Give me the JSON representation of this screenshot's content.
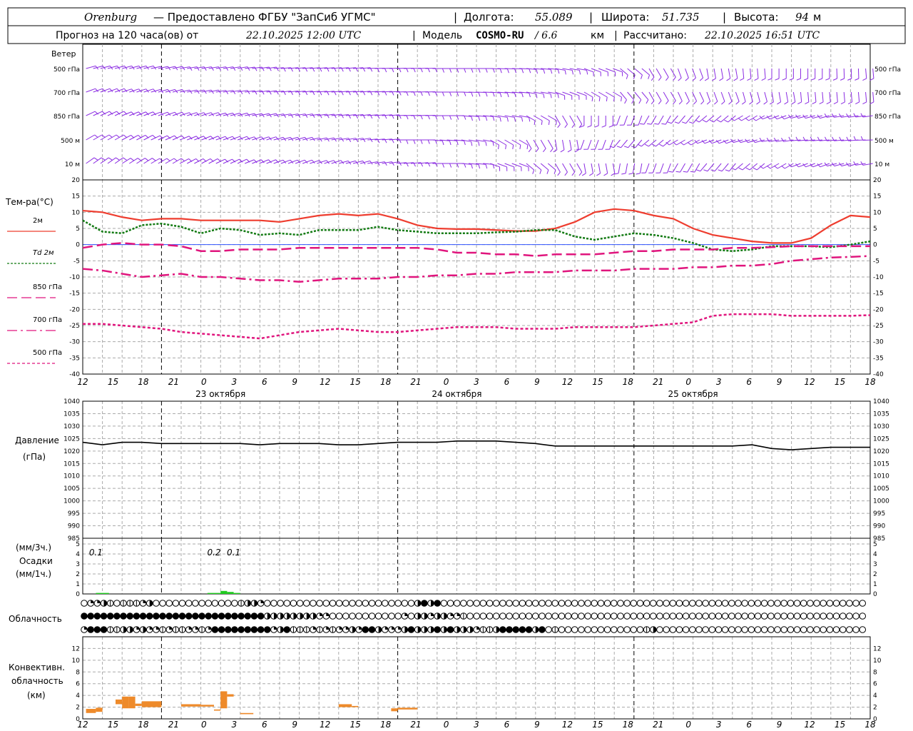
{
  "header": {
    "station": "Orenburg",
    "provider": "— Предоставлено ФГБУ \"ЗапСиб УГМС\"",
    "lon_label": "Долгота:",
    "lon_value": "55.089",
    "lat_label": "Широта:",
    "lat_value": "51.735",
    "alt_label": "Высота:",
    "alt_value": "94",
    "alt_unit": "м",
    "forecast_prefix": "Прогноз на 120 часа(ов) от",
    "forecast_start": "22.10.2025 12:00 UTC",
    "model_label": "Модель",
    "model_name": "COSMO-RU",
    "model_res": "/ 6.6",
    "model_res_unit": "км",
    "computed_label": "Рассчитано:",
    "computed_value": "22.10.2025 16:51 UTC"
  },
  "colors": {
    "t2m": "#ee3d2f",
    "td2m": "#127a12",
    "t850": "#e0157d",
    "t700": "#e0157d",
    "t500": "#e0157d",
    "pressure": "#000000",
    "wind": "#8a2be2",
    "precip": "#22cc22",
    "convective": "#ee8a2a",
    "zero_line": "#3355ff"
  },
  "time_axis": {
    "hour_labels": [
      "12",
      "15",
      "18",
      "21",
      "0",
      "3",
      "6",
      "9",
      "12",
      "15",
      "18",
      "21",
      "0",
      "3",
      "6",
      "9",
      "12",
      "15",
      "18",
      "21",
      "0",
      "3",
      "6",
      "9",
      "12",
      "15",
      "18"
    ],
    "day_labels": [
      {
        "text": "23 октября",
        "at_hour": 9
      },
      {
        "text": "24 октября",
        "at_hour": 9
      },
      {
        "text": "25 октября",
        "at_hour": 9
      }
    ]
  },
  "wind_panel": {
    "title": "Ветер",
    "levels": [
      "500 гПа",
      "700 гПа",
      "850 гПа",
      "500 м",
      "10  м"
    ]
  },
  "chart_data": [
    {
      "type": "line",
      "title": "Тем-ра(°C)",
      "ylim": [
        -40,
        20
      ],
      "yticks": [
        20,
        15,
        10,
        5,
        0,
        -5,
        -10,
        -15,
        -20,
        -25,
        -30,
        -35,
        -40
      ],
      "x_hours": [
        0,
        3,
        6,
        9,
        12,
        15,
        18,
        21,
        24,
        27,
        30,
        33,
        36,
        39,
        42,
        45,
        48,
        51,
        54,
        57,
        60,
        63,
        66,
        69,
        72,
        75,
        78,
        81,
        84,
        87,
        90,
        93,
        96,
        99,
        102,
        105,
        108,
        111,
        114,
        117,
        120
      ],
      "series": [
        {
          "name": "2м",
          "style": "solid",
          "values": [
            10.5,
            10,
            8.5,
            7.5,
            8,
            8,
            7.5,
            7.5,
            7.5,
            7.5,
            7,
            8,
            9,
            9.5,
            9,
            9.5,
            8,
            6,
            5,
            4.8,
            4.8,
            4.5,
            4.2,
            4.2,
            5,
            7,
            10,
            11,
            10.5,
            9,
            8,
            5,
            3,
            2,
            1,
            0.5,
            0.5,
            2,
            6,
            9,
            8.5
          ]
        },
        {
          "name": "Td 2м",
          "style": "dotted",
          "values": [
            7.5,
            4,
            3.5,
            6,
            6.5,
            5.5,
            3.5,
            5,
            4.5,
            3,
            3.5,
            3,
            4.5,
            4.5,
            4.5,
            5.5,
            4.5,
            4,
            3.5,
            3.5,
            3.5,
            3.8,
            4,
            4.5,
            4.5,
            2.5,
            1.5,
            2.5,
            3.5,
            3,
            2,
            0.5,
            -1.5,
            -2,
            -1.5,
            -0.5,
            -0.5,
            -0.5,
            -0.8,
            0,
            1
          ]
        },
        {
          "name": "850 гПа",
          "style": "dash",
          "values": [
            -1,
            0,
            0.5,
            0,
            0,
            -0.5,
            -2,
            -2,
            -1.5,
            -1.5,
            -1.5,
            -1,
            -1,
            -1,
            -1,
            -1,
            -1,
            -1,
            -1.5,
            -2.5,
            -2.5,
            -3,
            -3,
            -3.5,
            -3,
            -3,
            -3,
            -2.5,
            -2,
            -2,
            -1.5,
            -1.5,
            -1.5,
            -1,
            -1,
            -0.8,
            -0.5,
            -0.5,
            -0.5,
            -0.5,
            -0.5
          ]
        },
        {
          "name": "700 гПа",
          "style": "dashdot",
          "values": [
            -7.5,
            -8,
            -9,
            -10,
            -9.5,
            -9,
            -10,
            -10,
            -10.5,
            -11,
            -11,
            -11.5,
            -11,
            -10.5,
            -10.5,
            -10.5,
            -10,
            -10,
            -9.5,
            -9.5,
            -9,
            -9,
            -8.5,
            -8.5,
            -8.5,
            -8,
            -8,
            -8,
            -7.5,
            -7.5,
            -7.5,
            -7,
            -7,
            -6.5,
            -6.5,
            -6,
            -5,
            -4.5,
            -4,
            -3.8,
            -3.5
          ]
        },
        {
          "name": "500 гПа",
          "style": "shortdash",
          "values": [
            -24.5,
            -24.5,
            -25,
            -25.5,
            -26,
            -27,
            -27.5,
            -28,
            -28.5,
            -29,
            -28,
            -27,
            -26.5,
            -26,
            -26.5,
            -27,
            -27,
            -26.5,
            -26,
            -25.5,
            -25.5,
            -25.5,
            -26,
            -26,
            -26,
            -25.5,
            -25.5,
            -25.5,
            -25.5,
            -25,
            -24.5,
            -24,
            -22,
            -21.5,
            -21.5,
            -21.5,
            -22,
            -22,
            -22,
            -22,
            -21.8
          ]
        }
      ]
    },
    {
      "type": "line",
      "title": "Давление",
      "ylabel": "(гПа)",
      "ylim": [
        985,
        1040
      ],
      "yticks": [
        1040,
        1035,
        1030,
        1025,
        1020,
        1015,
        1010,
        1005,
        1000,
        995,
        990,
        985
      ],
      "x_hours": [
        0,
        3,
        6,
        9,
        12,
        15,
        18,
        21,
        24,
        27,
        30,
        33,
        36,
        39,
        42,
        45,
        48,
        51,
        54,
        57,
        60,
        63,
        66,
        69,
        72,
        75,
        78,
        81,
        84,
        87,
        90,
        93,
        96,
        99,
        102,
        105,
        108,
        111,
        114,
        117,
        120
      ],
      "series": [
        {
          "name": "pressure",
          "values": [
            1023.5,
            1022.5,
            1023.5,
            1023.5,
            1023,
            1023,
            1023,
            1023,
            1023,
            1022.5,
            1023,
            1023,
            1023,
            1022.5,
            1022.5,
            1023,
            1023.5,
            1023.5,
            1023.5,
            1024,
            1024,
            1024,
            1023.5,
            1023,
            1022,
            1022,
            1022,
            1022,
            1022,
            1022,
            1022,
            1022,
            1022,
            1022,
            1022.5,
            1021,
            1020.5,
            1021,
            1021.5,
            1021.5,
            1021.5
          ]
        }
      ]
    },
    {
      "type": "bar",
      "title": "Осадки",
      "ylabel_top": "(мм/3ч.)",
      "ylabel_bottom": "(мм/1ч.)",
      "ylim": [
        0,
        5
      ],
      "yticks": [
        5,
        4,
        3,
        2,
        1,
        0
      ],
      "annotations": [
        {
          "text": "0.1",
          "at_hour": 2
        },
        {
          "text": "0.2",
          "at_hour": 20
        },
        {
          "text": "0.1",
          "at_hour": 23
        }
      ],
      "hourly": [
        {
          "hour": 2,
          "value": 0.1
        },
        {
          "hour": 3,
          "value": 0.1
        },
        {
          "hour": 19,
          "value": 0.1
        },
        {
          "hour": 20,
          "value": 0.1
        },
        {
          "hour": 21,
          "value": 0.3
        },
        {
          "hour": 22,
          "value": 0.2
        },
        {
          "hour": 23,
          "value": 0.1
        }
      ]
    },
    {
      "type": "bar",
      "title": "Конвективн. облачность",
      "ylabel": "(км)",
      "ylim": [
        0,
        14
      ],
      "yticks": [
        12,
        10,
        8,
        6,
        4,
        2,
        0
      ],
      "segments": [
        {
          "h0": 0.5,
          "h1": 2,
          "base": 1,
          "top": 1.7
        },
        {
          "h0": 2,
          "h1": 3,
          "base": 1.2,
          "top": 1.9
        },
        {
          "h0": 5,
          "h1": 6,
          "base": 2.5,
          "top": 3.3
        },
        {
          "h0": 6,
          "h1": 7,
          "base": 1.8,
          "top": 3.8
        },
        {
          "h0": 7,
          "h1": 8,
          "base": 1.8,
          "top": 3.8
        },
        {
          "h0": 8,
          "h1": 9,
          "base": 2.2,
          "top": 2.6
        },
        {
          "h0": 9,
          "h1": 12,
          "base": 2,
          "top": 3
        },
        {
          "h0": 15,
          "h1": 18,
          "base": 2.1,
          "top": 2.5
        },
        {
          "h0": 18,
          "h1": 20,
          "base": 2.1,
          "top": 2.4
        },
        {
          "h0": 20,
          "h1": 21,
          "base": 1.4,
          "top": 1.6
        },
        {
          "h0": 21,
          "h1": 22,
          "base": 1.8,
          "top": 4.7
        },
        {
          "h0": 22,
          "h1": 23,
          "base": 3.8,
          "top": 4.2
        },
        {
          "h0": 24,
          "h1": 26,
          "base": 0.8,
          "top": 1
        },
        {
          "h0": 39,
          "h1": 41,
          "base": 2,
          "top": 2.5
        },
        {
          "h0": 41,
          "h1": 42,
          "base": 2,
          "top": 2.2
        },
        {
          "h0": 47,
          "h1": 48,
          "base": 1.3,
          "top": 1.8
        },
        {
          "h0": 48,
          "h1": 51,
          "base": 1.6,
          "top": 1.9
        }
      ]
    }
  ],
  "cloud_panel": {
    "title": "Облачность",
    "rows": [
      [
        0,
        2,
        2,
        3,
        1,
        0,
        1,
        1,
        1,
        2,
        3,
        0,
        0,
        0,
        0,
        0,
        0,
        0,
        0,
        0,
        0,
        0,
        0,
        0,
        1,
        3,
        3,
        2,
        0,
        0,
        0,
        0,
        0,
        0,
        0,
        0,
        0,
        0,
        0,
        0,
        0,
        0,
        0,
        0,
        0,
        0,
        0,
        0,
        0,
        0,
        0,
        3,
        4,
        3,
        4,
        0,
        0,
        0,
        0,
        0,
        0,
        0,
        0,
        0,
        0,
        0,
        0,
        0,
        0,
        0,
        0,
        0,
        0,
        0,
        0,
        0,
        0,
        0,
        0,
        0,
        0,
        0,
        0,
        0,
        0,
        0,
        0,
        0,
        0,
        0,
        0,
        0,
        0,
        0,
        0,
        0,
        0,
        0,
        0,
        0,
        0,
        0,
        0,
        0,
        0,
        0,
        0,
        0,
        0,
        0,
        0,
        0,
        0,
        0,
        0,
        0,
        0,
        0,
        0,
        0
      ],
      [
        4,
        4,
        4,
        4,
        4,
        4,
        4,
        4,
        4,
        4,
        4,
        4,
        4,
        4,
        4,
        4,
        4,
        4,
        4,
        4,
        4,
        4,
        4,
        4,
        4,
        4,
        4,
        4,
        3,
        3,
        3,
        3,
        3,
        3,
        3,
        3,
        2,
        2,
        0,
        0,
        0,
        0,
        0,
        0,
        0,
        0,
        0,
        0,
        0,
        2,
        0,
        3,
        3,
        2,
        3,
        3,
        2,
        2,
        1,
        0,
        0,
        0,
        0,
        0,
        0,
        0,
        0,
        0,
        0,
        0,
        0,
        0,
        0,
        0,
        0,
        0,
        0,
        0,
        0,
        0,
        0,
        0,
        0,
        0,
        0,
        0,
        0,
        0,
        0,
        0,
        0,
        0,
        0,
        0,
        0,
        0,
        0,
        0,
        0,
        0,
        0,
        0,
        0,
        0,
        0,
        0,
        0,
        0,
        0,
        0,
        0,
        0,
        0,
        0,
        0,
        0,
        0,
        0,
        0,
        0
      ],
      [
        2,
        4,
        4,
        4,
        1,
        1,
        3,
        3,
        2,
        3,
        2,
        2,
        1,
        2,
        1,
        1,
        2,
        2,
        1,
        2,
        4,
        4,
        4,
        4,
        4,
        4,
        4,
        4,
        4,
        2,
        3,
        4,
        1,
        1,
        1,
        2,
        1,
        2,
        1,
        2,
        2,
        3,
        2,
        4,
        4,
        3,
        2,
        2,
        2,
        3,
        4,
        3,
        3,
        3,
        4,
        3,
        4,
        3,
        3,
        3,
        2,
        1,
        1,
        3,
        4,
        4,
        4,
        4,
        4,
        3,
        4,
        0,
        1,
        0,
        0,
        0,
        0,
        0,
        0,
        0,
        0,
        0,
        0,
        0,
        0,
        0,
        1,
        3,
        0,
        0,
        0,
        0,
        0,
        0,
        0,
        0,
        0,
        0,
        0,
        0,
        0,
        0,
        0,
        0,
        0,
        0,
        0,
        0,
        0,
        0,
        0,
        0,
        0,
        0,
        0,
        0,
        0,
        0,
        0,
        0
      ]
    ]
  }
}
